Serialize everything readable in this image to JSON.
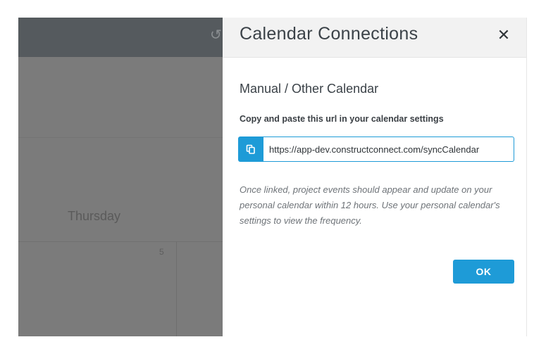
{
  "background": {
    "header_icon": "history-icon",
    "day_label": "Thursday",
    "date_number": "5"
  },
  "modal": {
    "title": "Calendar Connections",
    "close_label": "✕",
    "section_title": "Manual / Other Calendar",
    "instruction": "Copy and paste this url in your calendar settings",
    "copy_icon": "copy-icon",
    "url_value": "https://app-dev.constructconnect.com/syncCalendar",
    "note": "Once linked, project events should appear and update on your personal calendar within 12 hours. Use your personal calendar's settings to view the frequency.",
    "ok_label": "OK"
  },
  "colors": {
    "accent": "#1e9bd7",
    "overlay": "#7b7b7b",
    "header_dark": "#555a5e",
    "modal_header": "#f2f2f2",
    "text_dark": "#3b4248",
    "text_muted": "#6e7378"
  }
}
